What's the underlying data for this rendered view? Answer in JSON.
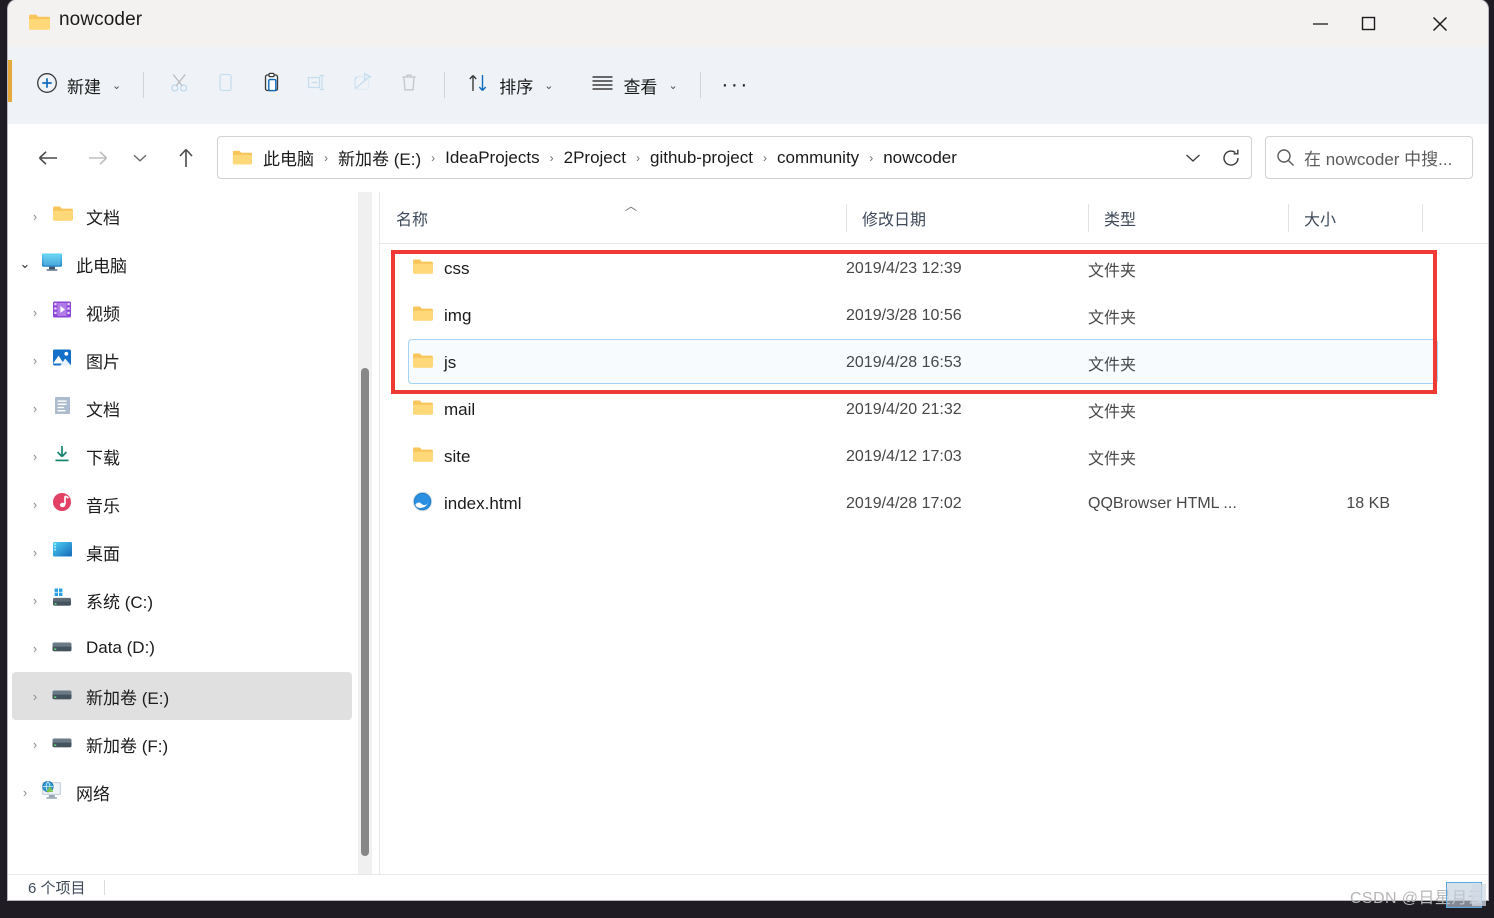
{
  "window": {
    "title": "nowcoder",
    "controls": {
      "minimize": "Minimize",
      "maximize": "Maximize",
      "close": "Close"
    }
  },
  "commandbar": {
    "new_label": "新建",
    "cut_label": "剪切",
    "copy_label": "复制",
    "paste_label": "粘贴",
    "rename_label": "重命名",
    "share_label": "共享",
    "delete_label": "删除",
    "sort_label": "排序",
    "view_label": "查看",
    "more_label": "···"
  },
  "navigation": {
    "back": "后退",
    "forward": "前进",
    "recent": "最近浏览的位置",
    "up": "向上"
  },
  "addressbar": {
    "crumbs": [
      "此电脑",
      "新加卷 (E:)",
      "IdeaProjects",
      "2Project",
      "github-project",
      "community",
      "nowcoder"
    ],
    "separator": "›",
    "dropdown": "⌄",
    "refresh": "刷新"
  },
  "search": {
    "placeholder": "在 nowcoder 中搜...",
    "icon": "search-icon"
  },
  "sidebar": {
    "items": [
      {
        "label": "文档",
        "icon": "folder-yellow-icon",
        "depth": 1,
        "expandable": true,
        "expanded": false,
        "selected": false
      },
      {
        "label": "此电脑",
        "icon": "this-pc-icon",
        "depth": 0,
        "expandable": true,
        "expanded": true,
        "selected": false
      },
      {
        "label": "视频",
        "icon": "videos-icon",
        "depth": 1,
        "expandable": true,
        "expanded": false,
        "selected": false
      },
      {
        "label": "图片",
        "icon": "pictures-icon",
        "depth": 1,
        "expandable": true,
        "expanded": false,
        "selected": false
      },
      {
        "label": "文档",
        "icon": "documents-icon",
        "depth": 1,
        "expandable": true,
        "expanded": false,
        "selected": false
      },
      {
        "label": "下载",
        "icon": "downloads-icon",
        "depth": 1,
        "expandable": true,
        "expanded": false,
        "selected": false
      },
      {
        "label": "音乐",
        "icon": "music-icon",
        "depth": 1,
        "expandable": true,
        "expanded": false,
        "selected": false
      },
      {
        "label": "桌面",
        "icon": "desktop-icon",
        "depth": 1,
        "expandable": true,
        "expanded": false,
        "selected": false
      },
      {
        "label": "系统 (C:)",
        "icon": "system-drive-icon",
        "depth": 1,
        "expandable": true,
        "expanded": false,
        "selected": false
      },
      {
        "label": "Data (D:)",
        "icon": "drive-icon",
        "depth": 1,
        "expandable": true,
        "expanded": false,
        "selected": false
      },
      {
        "label": "新加卷 (E:)",
        "icon": "drive-icon",
        "depth": 1,
        "expandable": true,
        "expanded": false,
        "selected": true
      },
      {
        "label": "新加卷 (F:)",
        "icon": "drive-icon",
        "depth": 1,
        "expandable": true,
        "expanded": false,
        "selected": false
      },
      {
        "label": "网络",
        "icon": "network-icon",
        "depth": 0,
        "expandable": true,
        "expanded": false,
        "selected": false
      }
    ]
  },
  "filelist": {
    "columns": [
      "名称",
      "修改日期",
      "类型",
      "大小"
    ],
    "sort_column": "名称",
    "sort_direction": "ascending",
    "rows": [
      {
        "name": "css",
        "date": "2019/4/23 12:39",
        "type": "文件夹",
        "size": "",
        "icon": "folder-yellow-icon",
        "focused": false
      },
      {
        "name": "img",
        "date": "2019/3/28 10:56",
        "type": "文件夹",
        "size": "",
        "icon": "folder-yellow-icon",
        "focused": false
      },
      {
        "name": "js",
        "date": "2019/4/28 16:53",
        "type": "文件夹",
        "size": "",
        "icon": "folder-yellow-icon",
        "focused": true
      },
      {
        "name": "mail",
        "date": "2019/4/20 21:32",
        "type": "文件夹",
        "size": "",
        "icon": "folder-yellow-icon",
        "focused": false
      },
      {
        "name": "site",
        "date": "2019/4/12 17:03",
        "type": "文件夹",
        "size": "",
        "icon": "folder-yellow-icon",
        "focused": false
      },
      {
        "name": "index.html",
        "date": "2019/4/28 17:02",
        "type": "QQBrowser HTML ...",
        "size": "18 KB",
        "icon": "qqbrowser-icon",
        "focused": false
      }
    ]
  },
  "statusbar": {
    "item_count": "6 个项目"
  },
  "annotation": {
    "highlight_color": "#f03a34",
    "focus_color": "#a5d3f3",
    "highlighted_rows": [
      "css",
      "img",
      "js"
    ]
  },
  "watermark": {
    "text": "CSDN @日星月云"
  }
}
